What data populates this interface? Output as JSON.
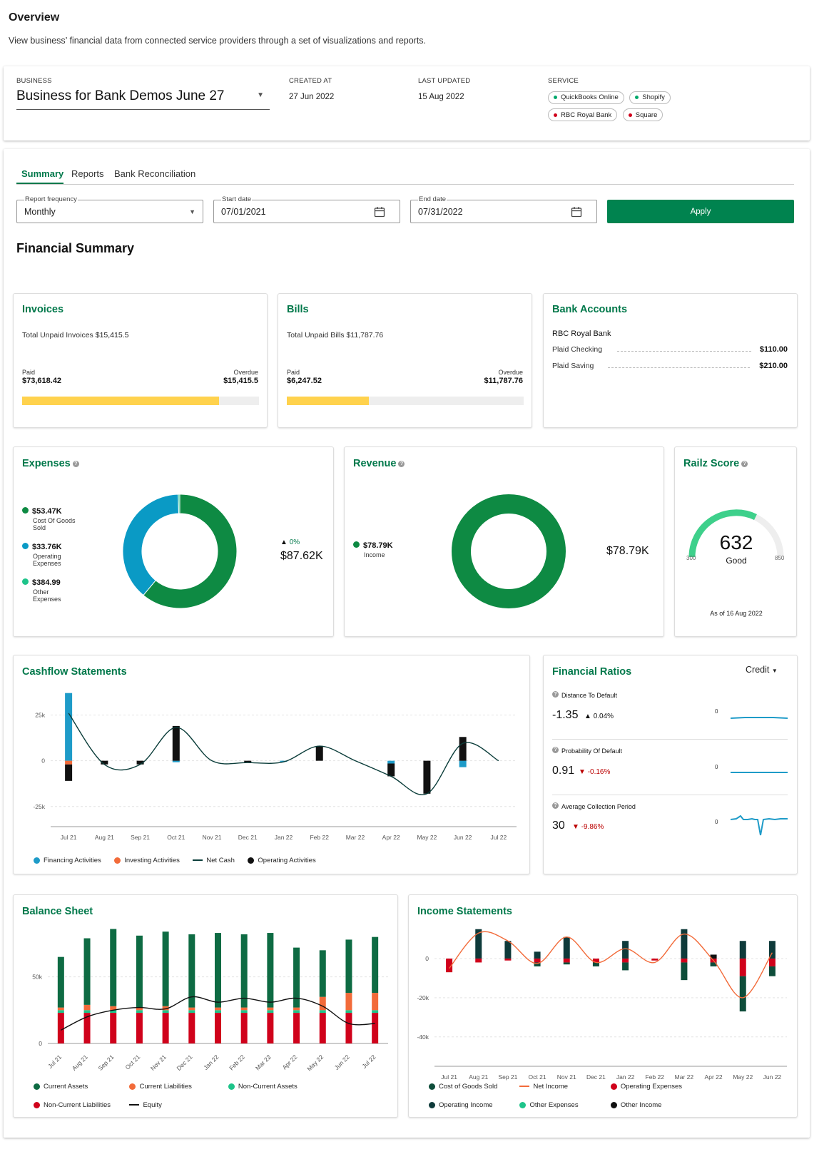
{
  "page": {
    "title": "Overview",
    "subtitle": "View business’ financial data from connected service providers through a set of visualizations and reports."
  },
  "business": {
    "label": "BUSINESS",
    "name": "Business for Bank Demos June 27",
    "created_label": "CREATED AT",
    "created": "27 Jun 2022",
    "updated_label": "LAST UPDATED",
    "updated": "15 Aug 2022",
    "service_label": "SERVICE",
    "services": [
      {
        "name": "QuickBooks Online",
        "color": "#00a86b"
      },
      {
        "name": "Shopify",
        "color": "#00a86b"
      },
      {
        "name": "RBC Royal Bank",
        "color": "#d0021b"
      },
      {
        "name": "Square",
        "color": "#d0021b"
      }
    ]
  },
  "tabs": [
    "Summary",
    "Reports",
    "Bank Reconciliation"
  ],
  "filters": {
    "frequency_label": "Report frequency",
    "frequency": "Monthly",
    "start_label": "Start date",
    "start": "07/01/2021",
    "end_label": "End date",
    "end": "07/31/2022",
    "apply": "Apply"
  },
  "section_title": "Financial Summary",
  "invoices": {
    "title": "Invoices",
    "total_label": "Total Unpaid Invoices",
    "total": "$15,415.5",
    "paid_label": "Paid",
    "paid": "$73,618.42",
    "overdue_label": "Overdue",
    "overdue": "$15,415.5",
    "paid_fraction": 0.83
  },
  "bills": {
    "title": "Bills",
    "total_label": "Total Unpaid Bills",
    "total": "$11,787.76",
    "paid_label": "Paid",
    "paid": "$6,247.52",
    "overdue_label": "Overdue",
    "overdue": "$11,787.76",
    "paid_fraction": 0.346
  },
  "bank_accounts": {
    "title": "Bank Accounts",
    "bank": "RBC Royal Bank",
    "accounts": [
      {
        "name": "Plaid Checking",
        "amount": "$110.00"
      },
      {
        "name": "Plaid Saving",
        "amount": "$210.00"
      }
    ]
  },
  "expenses": {
    "title": "Expenses",
    "items": [
      {
        "value": "$53.47K",
        "label": "Cost Of Goods Sold",
        "color": "#0e8a43"
      },
      {
        "value": "$33.76K",
        "label": "Operating Expenses",
        "color": "#0a9ac5"
      },
      {
        "value": "$384.99",
        "label": "Other Expenses",
        "color": "#1ec48a"
      }
    ],
    "change": "0%",
    "total": "$87.62K"
  },
  "revenue": {
    "title": "Revenue",
    "items": [
      {
        "value": "$78.79K",
        "label": "Income",
        "color": "#0e8a43"
      }
    ],
    "total": "$78.79K"
  },
  "railz_score": {
    "title": "Railz Score",
    "score": "632",
    "rating": "Good",
    "min": "300",
    "max": "850",
    "as_of": "As of 16 Aug 2022"
  },
  "cashflow": {
    "title": "Cashflow Statements",
    "legend": [
      {
        "name": "Financing Activities",
        "color": "#1e9bc8",
        "kind": "dot"
      },
      {
        "name": "Investing Activities",
        "color": "#f26b3a",
        "kind": "dot"
      },
      {
        "name": "Net Cash",
        "color": "#0b3d3a",
        "kind": "line"
      },
      {
        "name": "Operating Activities",
        "color": "#111111",
        "kind": "dot"
      }
    ]
  },
  "financial_ratios": {
    "title": "Financial Ratios",
    "selector": "Credit",
    "items": [
      {
        "name": "Distance To Default",
        "value": "-1.35",
        "change": "0.04%",
        "dir": "up",
        "axis": "0"
      },
      {
        "name": "Probability Of Default",
        "value": "0.91",
        "change": "-0.16%",
        "dir": "down",
        "axis": "0"
      },
      {
        "name": "Average Collection Period",
        "value": "30",
        "change": "-9.86%",
        "dir": "down",
        "axis": "0"
      }
    ]
  },
  "balance_sheet": {
    "title": "Balance Sheet",
    "legend": [
      {
        "name": "Current Assets",
        "color": "#0e6b43",
        "kind": "dot"
      },
      {
        "name": "Current Liabilities",
        "color": "#f26b3a",
        "kind": "dot"
      },
      {
        "name": "Non-Current Assets",
        "color": "#1ec48a",
        "kind": "dot"
      },
      {
        "name": "Non-Current Liabilities",
        "color": "#d0021b",
        "kind": "dot"
      },
      {
        "name": "Equity",
        "color": "#111111",
        "kind": "line"
      }
    ]
  },
  "income_statements": {
    "title": "Income Statements",
    "legend": [
      {
        "name": "Cost of Goods Sold",
        "color": "#0e4d3a",
        "kind": "dot"
      },
      {
        "name": "Net Income",
        "color": "#f26b3a",
        "kind": "line"
      },
      {
        "name": "Operating Expenses",
        "color": "#d0021b",
        "kind": "dot"
      },
      {
        "name": "Operating Income",
        "color": "#0e3a3a",
        "kind": "dot"
      },
      {
        "name": "Other Expenses",
        "color": "#1ec48a",
        "kind": "dot"
      },
      {
        "name": "Other Income",
        "color": "#111111",
        "kind": "dot"
      }
    ]
  },
  "chart_data": [
    {
      "id": "expenses",
      "type": "pie",
      "labels": [
        "Cost Of Goods Sold",
        "Operating Expenses",
        "Other Expenses"
      ],
      "values": [
        53470,
        33760,
        384.99
      ],
      "colors": [
        "#0e8a43",
        "#0a9ac5",
        "#1ec48a"
      ]
    },
    {
      "id": "revenue",
      "type": "pie",
      "labels": [
        "Income"
      ],
      "values": [
        78790
      ],
      "colors": [
        "#0e8a43"
      ]
    },
    {
      "id": "cashflow",
      "type": "bar",
      "categories": [
        "Jul 21",
        "Aug 21",
        "Sep 21",
        "Oct 21",
        "Nov 21",
        "Dec 21",
        "Jan 22",
        "Feb 22",
        "Mar 22",
        "Apr 22",
        "May 22",
        "Jun 22",
        "Jul 22"
      ],
      "yticks": [
        25000,
        0,
        -25000
      ],
      "ytick_labels": [
        "25k",
        "0",
        "-25k"
      ],
      "ylim": [
        -36000,
        40000
      ],
      "series": [
        {
          "name": "Financing Activities",
          "values": [
            37000,
            0,
            0,
            -800,
            0,
            0,
            -600,
            0,
            0,
            -1500,
            0,
            -3500,
            0
          ]
        },
        {
          "name": "Investing Activities",
          "values": [
            -2000,
            0,
            0,
            0,
            0,
            0,
            0,
            0,
            0,
            0,
            0,
            0,
            0
          ]
        },
        {
          "name": "Operating Activities",
          "values": [
            -9000,
            -2000,
            -2000,
            19000,
            0,
            -1000,
            0,
            8000,
            0,
            -7000,
            -18000,
            13000,
            0
          ]
        },
        {
          "name": "Net Cash",
          "values": [
            26000,
            -2000,
            -2000,
            18200,
            0,
            -1000,
            -600,
            8000,
            0,
            -8500,
            -18000,
            9500,
            0
          ]
        }
      ]
    },
    {
      "id": "balance_sheet",
      "type": "bar",
      "categories": [
        "Jul 21",
        "Aug 21",
        "Sep 21",
        "Oct 21",
        "Nov 21",
        "Dec 21",
        "Jan 22",
        "Feb 22",
        "Mar 22",
        "Apr 22",
        "May 22",
        "Jun 22",
        "Jul 22"
      ],
      "yticks": [
        50000,
        0
      ],
      "ytick_labels": [
        "50k",
        "0"
      ],
      "ylim": [
        0,
        90000
      ],
      "series": [
        {
          "name": "Non-Current Liabilities",
          "values": [
            23000,
            23000,
            23000,
            23000,
            23000,
            23000,
            23000,
            23000,
            23000,
            23000,
            23000,
            23000,
            23000
          ]
        },
        {
          "name": "Non-Current Assets",
          "values": [
            2000,
            2000,
            2000,
            2000,
            2000,
            2000,
            2000,
            2000,
            2000,
            2000,
            2000,
            2000,
            2000
          ]
        },
        {
          "name": "Current Liabilities",
          "values": [
            2000,
            4000,
            3000,
            2000,
            3000,
            2000,
            2000,
            2000,
            2000,
            2000,
            10000,
            13000,
            13000
          ]
        },
        {
          "name": "Current Assets",
          "values": [
            38000,
            50000,
            58000,
            54000,
            56000,
            55000,
            56000,
            55000,
            56000,
            45000,
            35000,
            40000,
            42000
          ]
        },
        {
          "name": "Equity",
          "values": [
            10000,
            20000,
            25000,
            27000,
            26000,
            35000,
            31000,
            34000,
            31000,
            34000,
            28000,
            15000,
            15000
          ]
        }
      ]
    },
    {
      "id": "income_statements",
      "type": "bar",
      "categories": [
        "Jul 21",
        "Aug 21",
        "Sep 21",
        "Oct 21",
        "Nov 21",
        "Dec 21",
        "Jan 22",
        "Feb 22",
        "Mar 22",
        "Apr 22",
        "May 22",
        "Jun 22"
      ],
      "yticks": [
        0,
        -20000,
        -40000
      ],
      "ytick_labels": [
        "0",
        "-20k",
        "-40k"
      ],
      "ylim": [
        -55000,
        16000
      ],
      "series": [
        {
          "name": "Operating Income",
          "values": [
            0,
            15000,
            9000,
            3500,
            11000,
            0,
            9000,
            0,
            15000,
            0,
            9000,
            9000
          ]
        },
        {
          "name": "Operating Expenses",
          "values": [
            -7000,
            -2000,
            -1000,
            -2000,
            -2000,
            -2000,
            -2000,
            -1000,
            -2000,
            -2000,
            -9000,
            -4000
          ]
        },
        {
          "name": "Cost of Goods Sold",
          "values": [
            0,
            0,
            0,
            -2000,
            -1000,
            -2000,
            -4000,
            0,
            -9000,
            -2000,
            -18000,
            -5000
          ]
        },
        {
          "name": "Other Income",
          "values": [
            0,
            0,
            0,
            0,
            0,
            0,
            0,
            0,
            0,
            2000,
            0,
            0
          ]
        },
        {
          "name": "Net Income",
          "values": [
            -5000,
            13000,
            9000,
            -2500,
            11000,
            -2000,
            5000,
            -2000,
            12500,
            -1000,
            -20000,
            3000
          ]
        }
      ]
    }
  ]
}
